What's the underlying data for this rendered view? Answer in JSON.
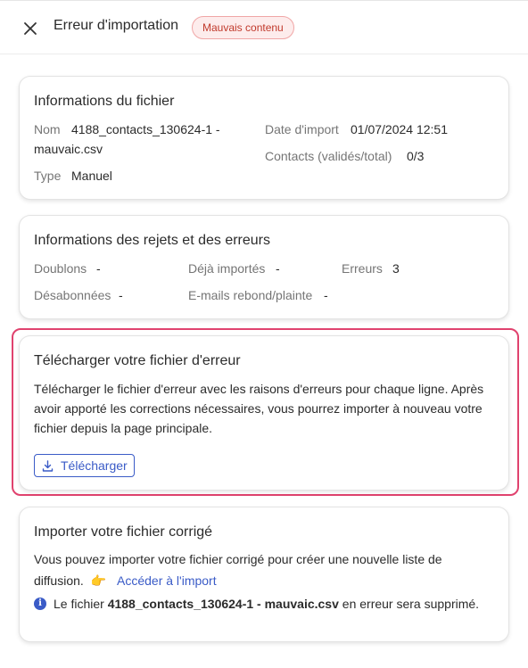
{
  "header": {
    "title": "Erreur d'importation",
    "badge": "Mauvais contenu"
  },
  "file_info": {
    "title": "Informations du fichier",
    "name_label": "Nom",
    "name_value_line1": "4188_contacts_130624-1 -",
    "name_value_line2": "mauvaic.csv",
    "type_label": "Type",
    "type_value": "Manuel",
    "date_label": "Date d'import",
    "date_value": "01/07/2024 12:51",
    "contacts_label": "Contacts (validés/total)",
    "contacts_value": "0/3"
  },
  "rejects": {
    "title": "Informations des rejets et des erreurs",
    "duplicates_label": "Doublons",
    "duplicates_value": "-",
    "already_label": "Déjà importés",
    "already_value": "-",
    "errors_label": "Erreurs",
    "errors_value": "3",
    "unsub_label": "Désabonnées",
    "unsub_value": "-",
    "bounce_label": "E-mails rebond/plainte",
    "bounce_value": "-"
  },
  "download": {
    "title": "Télécharger votre fichier d'erreur",
    "line1": "Télécharger le fichier d'erreur avec les raisons d'erreurs pour chaque ligne. Après",
    "line2": "avoir apporté les corrections nécessaires, vous pourrez importer à nouveau votre",
    "line3": "fichier depuis la page principale.",
    "button_label": "Télécharger",
    "highlight_color": "#e0426e"
  },
  "reimport": {
    "title": "Importer votre fichier corrigé",
    "line1": "Vous pouvez importer votre fichier corrigé pour créer une nouvelle liste de",
    "line2": "diffusion.",
    "emoji": "👉",
    "link_label": "Accéder à l'import",
    "info_prefix": "Le fichier ",
    "info_file": "4188_contacts_130624-1 - mauvaic.csv",
    "info_suffix": " en erreur sera supprimé."
  },
  "colors": {
    "accent": "#3a5bc7",
    "badge_text": "#c0392b",
    "badge_bg": "#fdecec"
  }
}
